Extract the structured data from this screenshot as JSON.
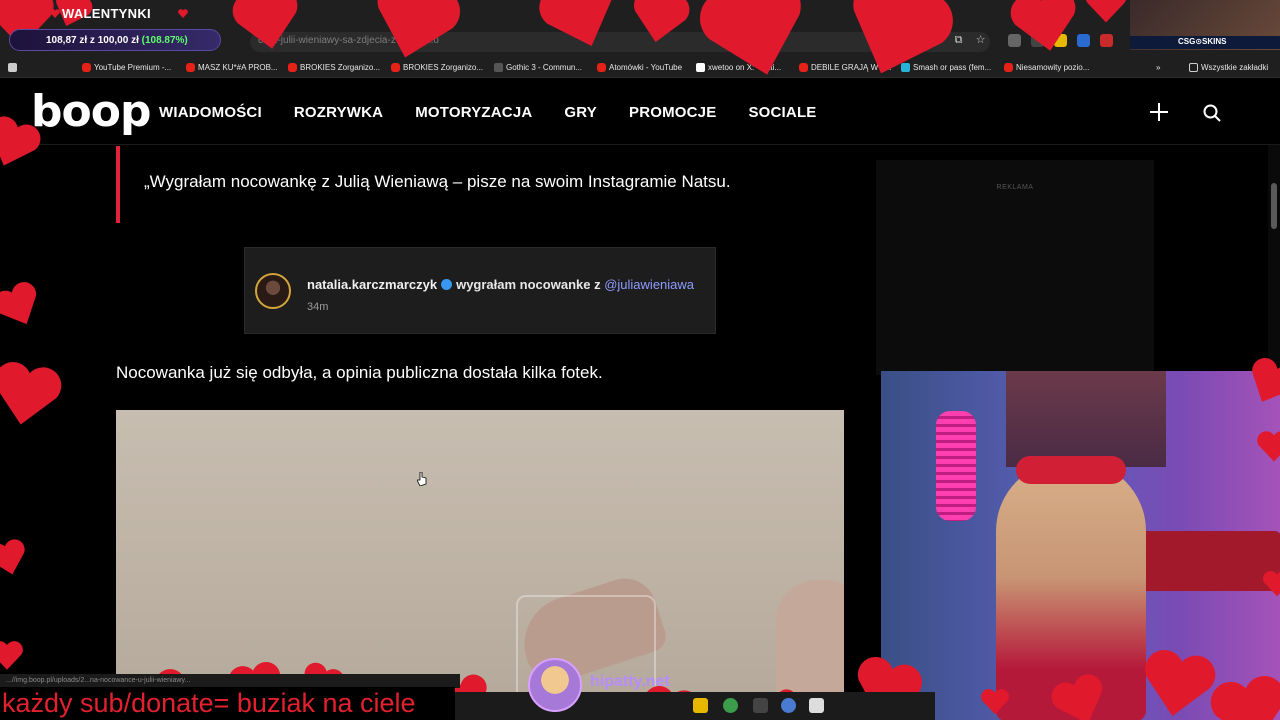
{
  "browser": {
    "url": "ce-u-julii-wieniawy-sa-zdjecia-z-sauny...o",
    "bookmarks": [
      {
        "label": "YouTube Premium -...",
        "icon": "youtube-icon"
      },
      {
        "label": "MASZ KU*#A PROB...",
        "icon": "youtube-icon"
      },
      {
        "label": "BROKIES Zorganizo...",
        "icon": "youtube-icon"
      },
      {
        "label": "BROKIES Zorganizo...",
        "icon": "youtube-icon"
      },
      {
        "label": "Gothic 3 - Commun...",
        "icon": "site-icon"
      },
      {
        "label": "Atomówki - YouTube",
        "icon": "youtube-icon"
      },
      {
        "label": "xwetoo on X: \"Mati...",
        "icon": "x-icon"
      },
      {
        "label": "DEBILE GRAJĄ W P...",
        "icon": "youtube-icon"
      },
      {
        "label": "Smash or pass (fem...",
        "icon": "site-icon"
      },
      {
        "label": "Niesamowity pozio...",
        "icon": "youtube-icon"
      }
    ],
    "all_bookmarks": "Wszystkie zakładki",
    "status_url": "...//img.boop.pl/uploads/2...na-nocowance-u-julii-wieniawy..."
  },
  "site": {
    "logo": "boop",
    "nav": [
      "WIADOMOŚCI",
      "ROZRYWKA",
      "MOTORYZACJA",
      "GRY",
      "PROMOCJE",
      "SOCIALE"
    ]
  },
  "article": {
    "quote": "„Wygrałam nocowankę z Julią Wieniawą – pisze na swoim Instagramie Natsu.",
    "instagram": {
      "username": "natalia.karczmarczyk",
      "message": "wygrałam nocowanke z",
      "mention": "@juliawieniawa",
      "time": "34m"
    },
    "paragraph": "Nocowanka już się odbyła, a opinia publiczna dostała kilka fotek."
  },
  "ad": {
    "label": "REKLAMA"
  },
  "stream": {
    "goal_title": "WALENTYNKI",
    "goal_progress": "108,87 zł z 100,00 zł",
    "goal_pct": "(108.87%)",
    "goal_fraction": 1.0887,
    "sponsor": "CSG⊙SKINS",
    "sub_text": "każdy sub/donate= buziak na ciele",
    "handle": "hipatty.net"
  },
  "colors": {
    "heart": "#e0192c",
    "accent": "#e0223a",
    "mention": "#8d9cff",
    "goal_pct": "#5cff6a"
  }
}
